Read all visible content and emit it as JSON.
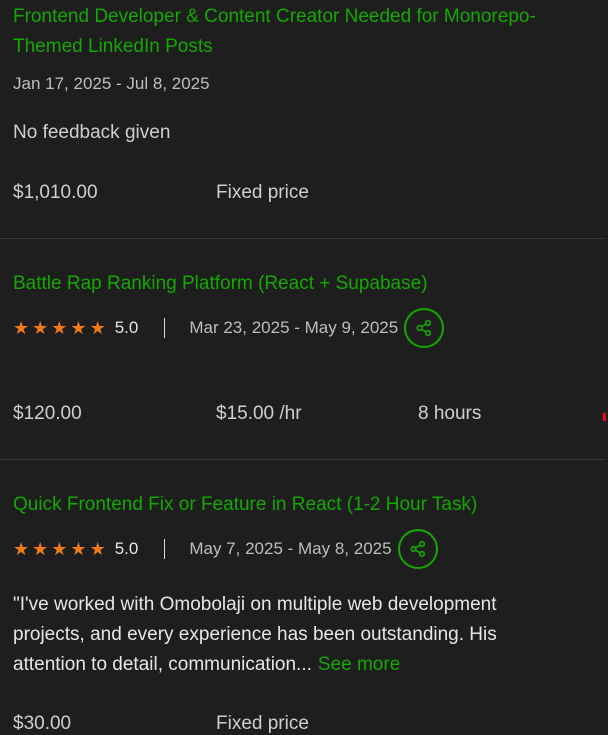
{
  "jobs": [
    {
      "title": "Frontend Developer & Content Creator Needed for Monorepo-Themed LinkedIn Posts",
      "dates": "Jan 17, 2025 - Jul 8, 2025",
      "feedback": "No feedback given",
      "earned": "$1,010.00",
      "rate_type": "Fixed price"
    },
    {
      "title": "Battle Rap Ranking Platform (React + Supabase)",
      "stars": 5,
      "score": "5.0",
      "dates": "Mar 23, 2025 - May 9, 2025",
      "earned": "$120.00",
      "rate": "$15.00 /hr",
      "hours": "8 hours"
    },
    {
      "title": "Quick Frontend Fix or Feature in React (1-2 Hour Task)",
      "stars": 5,
      "score": "5.0",
      "dates": "May 7, 2025 - May 8, 2025",
      "quote": "\"I've worked with Omobolaji on multiple web development projects, and every experience has been outstanding. His attention to detail, communication...",
      "see_more": "See more",
      "earned": "$30.00",
      "rate_type": "Fixed price"
    }
  ],
  "icons": {
    "star": "star-icon",
    "share": "share-icon"
  },
  "colors": {
    "accent": "#14a800",
    "star": "#ef7a16",
    "background": "#1e1e1e"
  }
}
